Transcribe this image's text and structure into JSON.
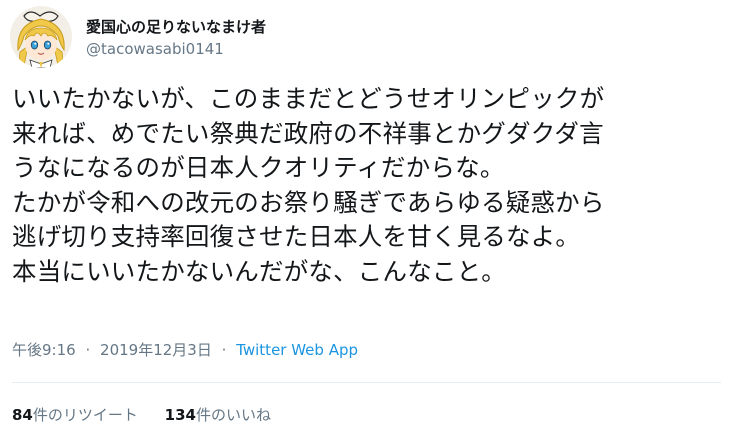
{
  "author": {
    "display_name": "愛国心の足りないなまけ者",
    "handle": "@tacowasabi0141"
  },
  "tweet": {
    "text": "いいたかないが、このままだとどうせオリンピックが\n来れば、めでたい祭典だ政府の不祥事とかグダクダ言\nうなになるのが日本人クオリティだからな。\nたかが令和への改元のお祭り騒ぎであらゆる疑惑から\n逃げ切り支持率回復させた日本人を甘く見るなよ。\n本当にいいたかないんだがな、こんなこと。"
  },
  "meta": {
    "time": "午後9:16",
    "separator": "·",
    "date": "2019年12月3日",
    "source": "Twitter Web App"
  },
  "stats": {
    "retweets_count": "84",
    "retweets_label": "件のリツイート",
    "likes_count": "134",
    "likes_label": "件のいいね"
  },
  "colors": {
    "text": "#14171a",
    "secondary": "#657786",
    "link": "#1b95e0"
  },
  "icons": {
    "avatar": "anime-girl-avatar-icon"
  }
}
